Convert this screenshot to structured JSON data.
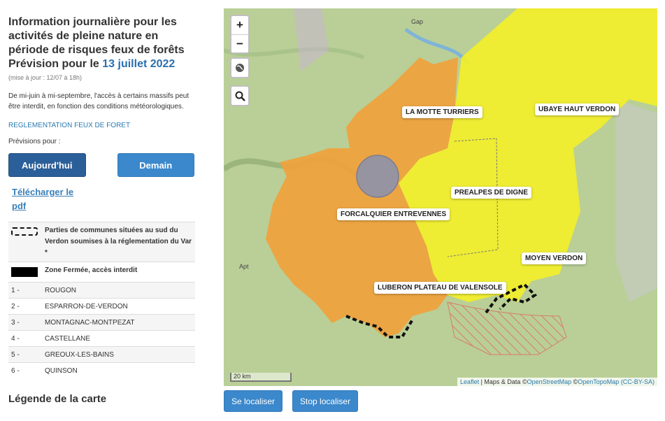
{
  "sidebar": {
    "title_lines": [
      "Information journalière pour les",
      "activités de pleine nature en",
      "période de risques feux de forêts"
    ],
    "forecast_prefix": "Prévision pour le",
    "forecast_date": "13 juillet 2022",
    "update": "(mise à jour : 12/07 à 18h)",
    "intro": "De mi-juin à mi-septembre, l'accès à certains massifs peut être interdit, en fonction des conditions météorologiques.",
    "regulation_link": "REGLEMENTATION FEUX DE FORET",
    "forecast_label": "Prévisions pour :",
    "today_button": "Aujourd'hui",
    "tomorrow_button": "Demain",
    "pdf_link": "Télécharger le pdf",
    "legend": [
      {
        "symbol": "dashed-outline",
        "text": "Parties de communes situées au sud du Verdon soumises à la réglementation du Var *"
      },
      {
        "symbol": "black-fill",
        "text": "Zone Fermée, accès interdit"
      }
    ],
    "communes": [
      {
        "num": "1 -",
        "name": "ROUGON"
      },
      {
        "num": "2 -",
        "name": "ESPARRON-DE-VERDON"
      },
      {
        "num": "3 -",
        "name": "MONTAGNAC-MONTPEZAT"
      },
      {
        "num": "4 -",
        "name": "CASTELLANE"
      },
      {
        "num": "5 -",
        "name": "GREOUX-LES-BAINS"
      },
      {
        "num": "6 -",
        "name": "QUINSON"
      }
    ],
    "bottom_title": "Légende de la carte"
  },
  "map": {
    "zoom_in": "+",
    "zoom_out": "−",
    "layers_icon": "globe-icon",
    "search_icon": "search-icon",
    "zones": {
      "la_motte": "LA MOTTE TURRIERS",
      "ubaye": "UBAYE HAUT VERDON",
      "prealpes": "PREALPES DE DIGNE",
      "forcalquier": "FORCALQUIER ENTREVENNES",
      "moyen_verdon": "MOYEN VERDON",
      "luberon": "LUBERON PLATEAU DE VALENSOLE"
    },
    "places": {
      "gap": "Gap",
      "apt": "Apt"
    },
    "scale": "20 km",
    "attribution": {
      "leaflet": "Leaflet",
      "sep1": " | Maps & Data ©",
      "osm": "OpenStreetMap",
      "sep2": " ©",
      "otm": "OpenTopoMap",
      "license": " (CC-BY-SA)"
    },
    "colors": {
      "orange_zone": "#f0a23c",
      "yellow_zone": "#f2ef2a",
      "terrain": "#b9cf97"
    }
  },
  "buttons": {
    "locate": "Se localiser",
    "stop_locate": "Stop localiser"
  }
}
